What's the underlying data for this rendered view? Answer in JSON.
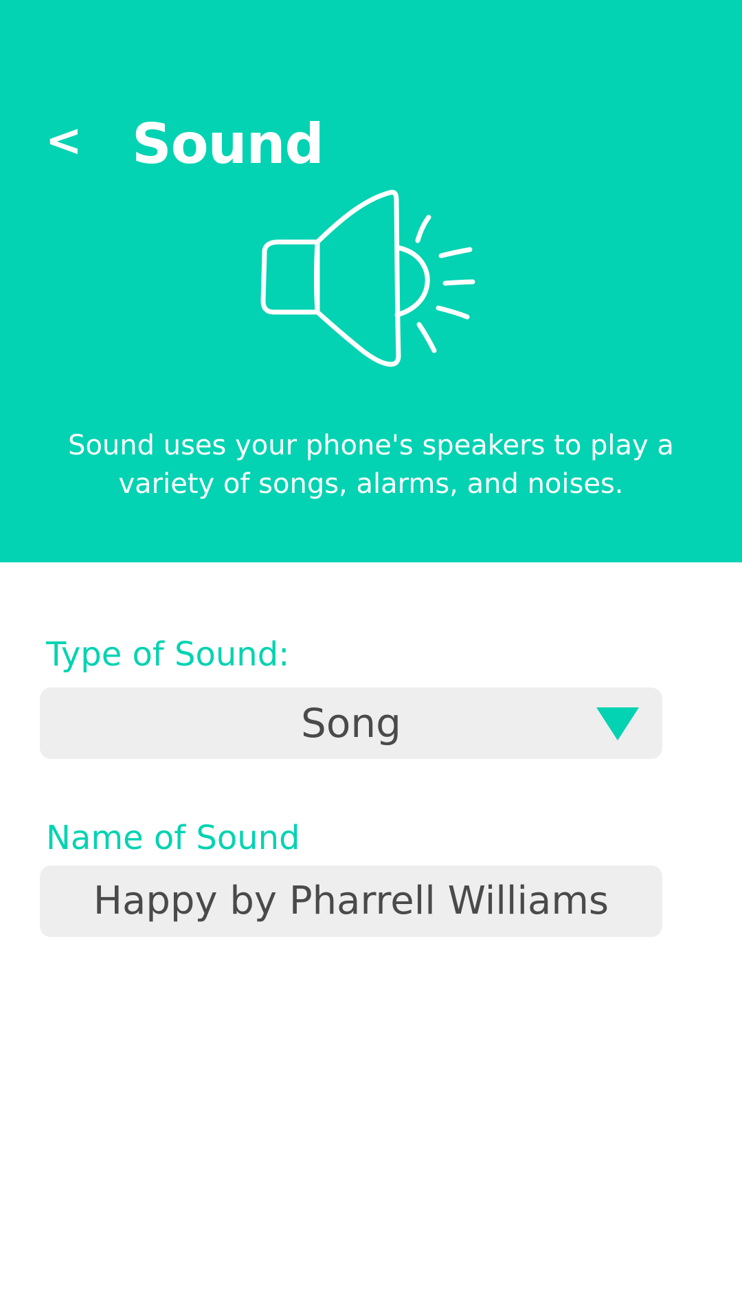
{
  "header": {
    "back_label": "<",
    "title": "Sound",
    "icon": "speaker-sound-icon",
    "description": "Sound uses your phone's speakers to play a variety of songs, alarms, and noises."
  },
  "form": {
    "type_label": "Type of Sound:",
    "type_value": "Song",
    "type_dropdown_icon": "triangle-down-icon",
    "name_label": "Name of Sound",
    "name_value": "Happy by Pharrell Williams"
  },
  "colors": {
    "accent": "#03d3b2",
    "field_background": "#eeeeee",
    "field_text": "#4a4a4a",
    "header_text": "#ffffff"
  }
}
